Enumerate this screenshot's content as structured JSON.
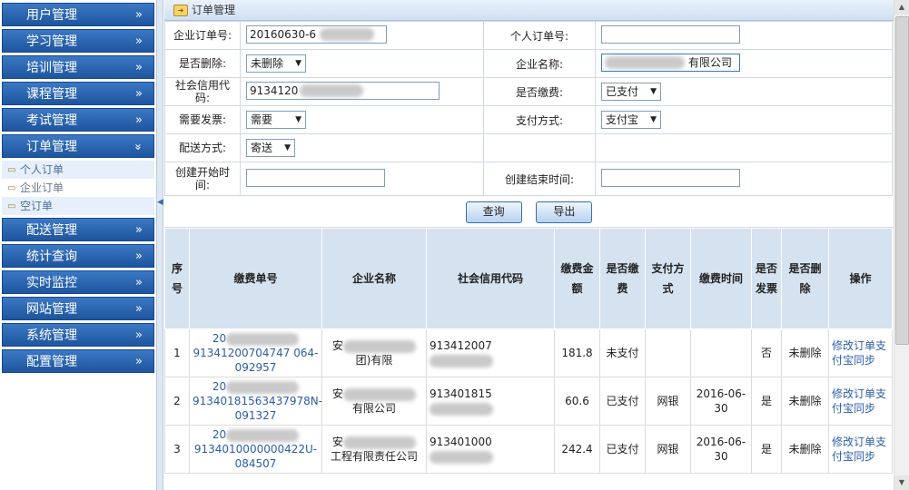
{
  "sidebar": {
    "menu_top": [
      "用户管理",
      "学习管理",
      "培训管理",
      "课程管理",
      "考试管理"
    ],
    "order_menu": "订单管理",
    "sub_items": [
      "个人订单",
      "企业订单",
      "空订单"
    ],
    "menu_bottom": [
      "配送管理",
      "统计查询",
      "实时监控",
      "网站管理",
      "系统管理",
      "配置管理"
    ],
    "chevron_right": "»",
    "chevron_down": "»"
  },
  "page": {
    "title": "订单管理"
  },
  "form": {
    "enterprise_order_label": "企业订单号:",
    "enterprise_order_value": "20160630-6",
    "personal_order_label": "个人订单号:",
    "deleted_label": "是否删除:",
    "deleted_value": "未删除",
    "company_label": "企业名称:",
    "company_value": "有限公司",
    "credit_label": "社会信用代码:",
    "credit_value": "9134120",
    "paid_label": "是否缴费:",
    "paid_value": "已支付",
    "invoice_label": "需要发票:",
    "invoice_value": "需要",
    "paymethod_label": "支付方式:",
    "paymethod_value": "支付宝",
    "delivery_label": "配送方式:",
    "delivery_value": "寄送",
    "start_label": "创建开始时间:",
    "end_label": "创建结束时间:"
  },
  "buttons": {
    "query": "查询",
    "export": "导出"
  },
  "table": {
    "headers": [
      "序号",
      "缴费单号",
      "企业名称",
      "社会信用代码",
      "缴费金额",
      "是否缴费",
      "支付方式",
      "缴费时间",
      "是否发票",
      "是否删除",
      "操作"
    ],
    "rows": [
      {
        "no": "1",
        "order_top": "20",
        "order_mid": "91341200704747 064-",
        "order_bot": "092957",
        "company": "安",
        "company2": "团)有限",
        "credit": "913412007",
        "amount": "181.8",
        "paid": "未支付",
        "method": "",
        "time": "",
        "invoice": "否",
        "deleted": "未删除",
        "op": "修改订单支付宝同步"
      },
      {
        "no": "2",
        "order_top": "20",
        "order_mid": "91340181563437978N-",
        "order_bot": "091327",
        "company": "安",
        "company2": "有限公司",
        "credit": "913401815",
        "amount": "60.6",
        "paid": "已支付",
        "method": "网银",
        "time": "2016-06-30",
        "invoice": "是",
        "deleted": "未删除",
        "op": "修改订单支付宝同步"
      },
      {
        "no": "3",
        "order_top": "20",
        "order_mid": "9134010000000422U-",
        "order_bot": "084507",
        "company": "安",
        "company2": "工程有限责任公司",
        "credit": "913401000",
        "amount": "242.4",
        "paid": "已支付",
        "method": "网银",
        "time": "2016-06-30",
        "invoice": "是",
        "deleted": "未删除",
        "op": "修改订单支付宝同步"
      }
    ]
  }
}
